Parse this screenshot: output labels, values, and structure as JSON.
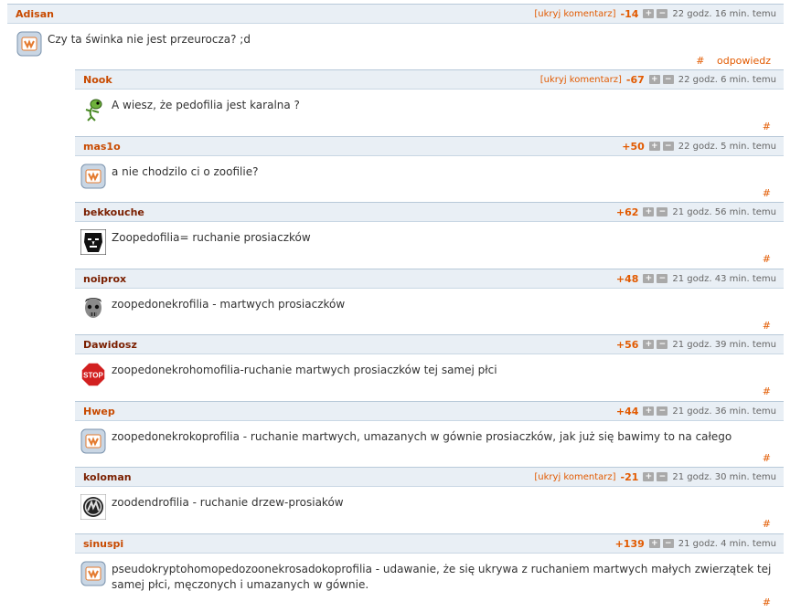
{
  "comments": [
    {
      "author": "Adisan",
      "hide_label": "[ukryj komentarz]",
      "score": "-14",
      "plus": "+",
      "minus": "−",
      "time": "22 godz. 16 min. temu",
      "text": "Czy ta świnka nie jest przeurocza? ;d",
      "hash": "#",
      "reply": "odpowiedz",
      "avatar": "default-avatar-icon"
    },
    {
      "author": "Nook",
      "hide_label": "[ukryj komentarz]",
      "score": "-67",
      "plus": "+",
      "minus": "−",
      "time": "22 godz. 6 min. temu",
      "text": "A wiesz, że pedofilia jest karalna ?",
      "hash": "#",
      "avatar": "lizard-avatar-icon"
    },
    {
      "author": "mas1o",
      "score": "+50",
      "plus": "+",
      "minus": "−",
      "time": "22 godz. 5 min. temu",
      "text": "a nie chodzilo ci o zoofilie?",
      "hash": "#",
      "avatar": "default-avatar-icon"
    },
    {
      "author": "bekkouche",
      "score": "+62",
      "plus": "+",
      "minus": "−",
      "time": "21 godz. 56 min. temu",
      "text": "Zoopedofilia= ruchanie prosiaczków",
      "hash": "#",
      "avatar": "obey-face-avatar-icon"
    },
    {
      "author": "noiprox",
      "score": "+48",
      "plus": "+",
      "minus": "−",
      "time": "21 godz. 43 min. temu",
      "text": "zoopedonekrofilia - martwych prosiaczków",
      "hash": "#",
      "avatar": "zombie-face-avatar-icon"
    },
    {
      "author": "Dawidosz",
      "score": "+56",
      "plus": "+",
      "minus": "−",
      "time": "21 godz. 39 min. temu",
      "text": "zoopedonekrohomofilia-ruchanie martwych prosiaczków tej samej płci",
      "hash": "#",
      "avatar": "stop-sign-avatar-icon",
      "stop_label": "STOP"
    },
    {
      "author": "Hwep",
      "score": "+44",
      "plus": "+",
      "minus": "−",
      "time": "21 godz. 36 min. temu",
      "text": "zoopedonekrokoprofilia - ruchanie martwych, umazanych w gównie prosiaczków, jak już się bawimy to na całego",
      "hash": "#",
      "avatar": "default-avatar-icon"
    },
    {
      "author": "koloman",
      "hide_label": "[ukryj komentarz]",
      "score": "-21",
      "plus": "+",
      "minus": "−",
      "time": "21 godz. 30 min. temu",
      "text": "zoodendrofilia - ruchanie drzew-prosiaków",
      "hash": "#",
      "avatar": "logo-circle-avatar-icon"
    },
    {
      "author": "sinuspi",
      "score": "+139",
      "plus": "+",
      "minus": "−",
      "time": "21 godz. 4 min. temu",
      "text": "pseudokryptohomopedozoonekrosadokoprofilia - udawanie, że się ukrywa z ruchaniem martwych małych zwierzątek tej samej płci, męczonych i umazanych w gównie.",
      "hash": "#",
      "avatar": "default-avatar-icon"
    }
  ]
}
